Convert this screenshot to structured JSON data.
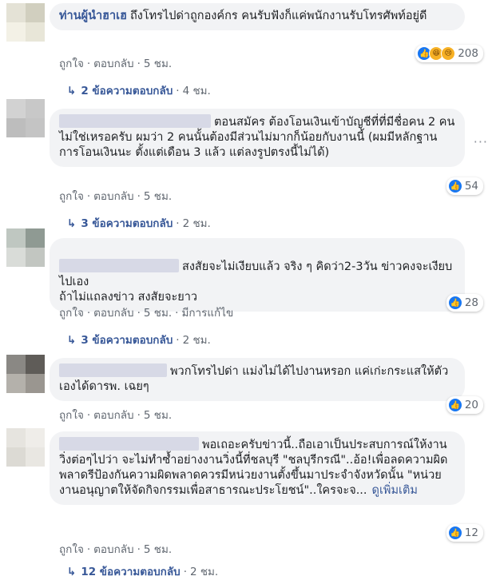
{
  "comments": [
    {
      "author": "ท่านผู้นำฮาเฮ",
      "text": "ถึงโทรไปด่าถูกองค์กร คนรับฟังก็แค่พนักงานรับโทรศัพท์อยู่ดี",
      "like_label": "ถูกใจ",
      "reply_label": "ตอบกลับ",
      "time": "5 ชม.",
      "reactions": {
        "icons": [
          "like-icon",
          "haha-icon",
          "sad-icon"
        ],
        "count": "208"
      },
      "replies": {
        "label": "2 ข้อความตอบกลับ",
        "time": "4 ชม."
      },
      "avatar_colors": [
        "#e4e2d6",
        "#d1cfbf",
        "#f3f1e6",
        "#e8e6d8"
      ]
    },
    {
      "author": "",
      "text": "ตอนสมัคร ต้องโอนเงินเข้าบัญชีที่ที่มีชื่อคน 2 คนไม่ใช่เหรอครับ ผมว่า 2 คนนั้นต้องมีส่วนไม่มากก็น้อยกับงานนี้ (ผมมีหลักฐานการโอนเงินนะ ตั้งแต่เดือน 3 แล้ว แต่ลงรูปตรงนี้ไม่ได้)",
      "like_label": "ถูกใจ",
      "reply_label": "ตอบกลับ",
      "time": "5 ชม.",
      "reactions": {
        "icons": [
          "like-icon"
        ],
        "count": "54"
      },
      "replies": {
        "label": "3 ข้อความตอบกลับ",
        "time": "2 ชม."
      },
      "avatar_colors": [
        "#d2d2d2",
        "#c8c8c8",
        "#bdbdbd",
        "#c4c4c4"
      ]
    },
    {
      "author": "",
      "text": "สงสัยจะไม่เงียบแล้ว จริง ๆ คิดว่า2-3วัน ข่าวคงจะเงียบไปเอง\nถ้าไม่แถลงข่าว สงสัยจะยาว",
      "like_label": "ถูกใจ",
      "reply_label": "ตอบกลับ",
      "time": "5 ชม.",
      "edited": "มีการแก้ไข",
      "reactions": {
        "icons": [
          "like-icon"
        ],
        "count": "28"
      },
      "replies": {
        "label": "3 ข้อความตอบกลับ",
        "time": "2 ชม."
      },
      "avatar_colors": [
        "#bfc7c1",
        "#8f9a93",
        "#d9dcd8",
        "#c2c6c1"
      ]
    },
    {
      "author": "",
      "text": "พวกโทรไปด่า แม่งไม่ได้ไปงานหรอก แค่เก่ะกระแสให้ตัวเองได้ดารพ. เฉยๆ",
      "like_label": "ถูกใจ",
      "reply_label": "ตอบกลับ",
      "time": "5 ชม.",
      "reactions": {
        "icons": [
          "like-icon"
        ],
        "count": "20"
      },
      "replies": null,
      "avatar_colors": [
        "#8a8884",
        "#5f5c58",
        "#b4b1ab",
        "#9a9690"
      ]
    },
    {
      "author": "",
      "text": "พอเถอะครับข่าวนี้..ถือเอาเป็นประสบการณ์ให้งานวิ่งต่อๆไปว่า จะไม่ทำซ้ำอย่างงานวิ่งนี้ที่ชลบุรี \"ชลบุรีกรณี\"..อ้อ!เพื่อลดความผิดพลาดรีป้องกันความผิดพลาดควรมีหน่วยงานตั้งขึ้นมาประจำจังหวัดนั้น \"หน่วยงานอนุญาตให้จัดกิจกรรมเพื่อสาธารณะประโยชน์\"..ใครจะจ...",
      "see_more": "ดูเพิ่มเติม",
      "like_label": "ถูกใจ",
      "reply_label": "ตอบกลับ",
      "time": "5 ชม.",
      "reactions": {
        "icons": [
          "like-icon"
        ],
        "count": "12"
      },
      "replies": {
        "label": "12 ข้อความตอบกลับ",
        "time": "2 ชม."
      },
      "avatar_colors": [
        "#e6e4df",
        "#efede9",
        "#dcdad4",
        "#e9e7e2"
      ]
    }
  ],
  "icons": {
    "more_options": "more-options-icon",
    "reply_arrow": "reply-arrow-icon"
  },
  "colors": {
    "link": "#385898",
    "bubble": "#f2f3f5",
    "meta": "#606770",
    "like": "#1877f2"
  }
}
